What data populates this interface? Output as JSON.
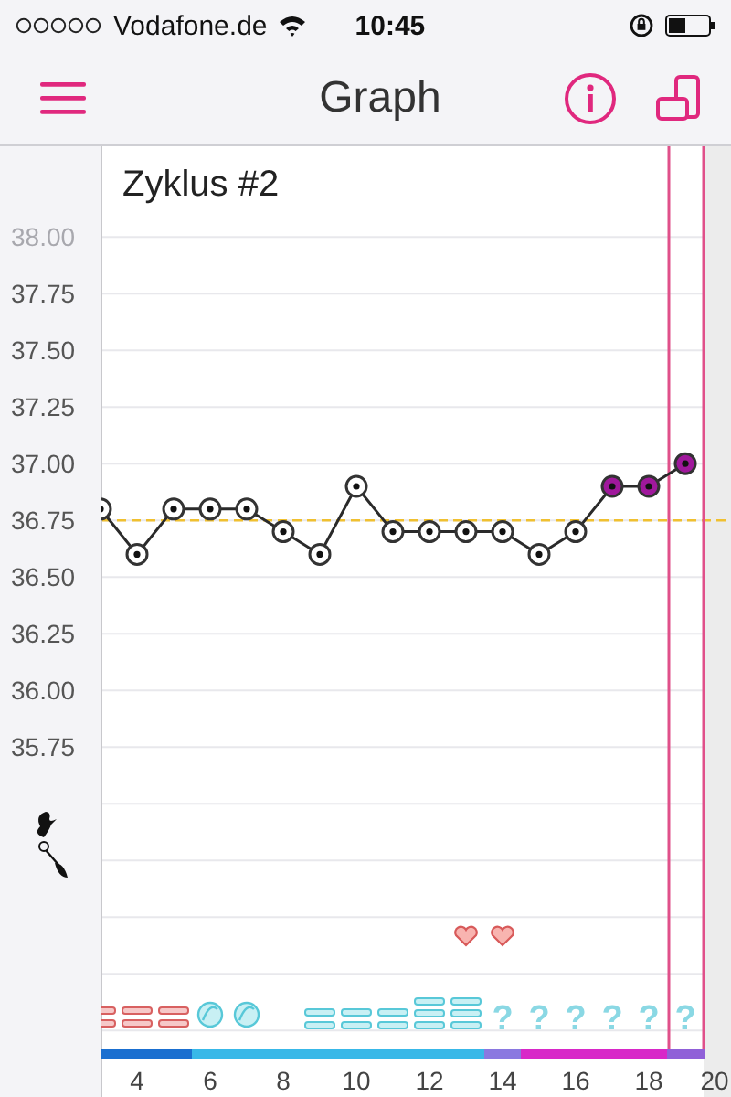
{
  "status_bar": {
    "carrier": "Vodafone.de",
    "time": "10:45"
  },
  "nav_bar": {
    "title": "Graph"
  },
  "chart": {
    "title": "Zyklus #2",
    "chart_data": {
      "type": "line",
      "x": [
        3,
        4,
        5,
        6,
        7,
        8,
        9,
        10,
        11,
        12,
        13,
        14,
        15,
        16,
        17,
        18,
        19
      ],
      "series": [
        {
          "color": "#ffffff",
          "marker": "circle",
          "values": [
            36.8,
            36.6,
            36.8,
            36.8,
            36.8,
            36.7,
            36.6,
            36.9,
            36.7,
            36.7,
            36.7,
            36.7,
            36.6,
            36.7,
            null,
            null,
            null
          ]
        },
        {
          "color": "#a0189c",
          "marker": "circle",
          "values": [
            null,
            null,
            null,
            null,
            null,
            null,
            null,
            null,
            null,
            null,
            null,
            null,
            null,
            36.7,
            36.9,
            36.9,
            37.0
          ]
        }
      ],
      "xlim": [
        3,
        20.25
      ],
      "ylim": [
        34.21,
        38.4
      ],
      "grid": true,
      "xticks": [
        4,
        6,
        8,
        10,
        12,
        14,
        16,
        18,
        20
      ],
      "yticks": [
        {
          "value": 38,
          "label": "38.00"
        },
        {
          "value": 37.75,
          "label": "37.75"
        },
        {
          "value": 37.5,
          "label": "37.50"
        },
        {
          "value": 37.25,
          "label": "37.25"
        },
        {
          "value": 37,
          "label": "37.00"
        },
        {
          "value": 36.75,
          "label": "36.75"
        },
        {
          "value": 36.5,
          "label": "36.50"
        },
        {
          "value": 36.25,
          "label": "36.25"
        },
        {
          "value": 36,
          "label": "36.00"
        },
        {
          "value": 35.75,
          "label": "35.75"
        }
      ],
      "ref_lines": [
        {
          "axis": "y",
          "value": 36.75,
          "color": "#f0c030"
        },
        {
          "axis": "x",
          "value": 18.55,
          "color": "#e0508a"
        },
        {
          "axis": "x",
          "value": 19.5,
          "color": "#e0508a"
        }
      ],
      "bands": [
        {
          "axis": "x",
          "from": 19.5,
          "to": 20.25,
          "color": "#ececec"
        }
      ]
    },
    "phases": [
      {
        "color": "#1a6fd0"
      },
      {
        "color": "#1a6fd0"
      },
      {
        "color": "#1a6fd0"
      },
      {
        "color": "#38b8e8"
      },
      {
        "color": "#38b8e8"
      },
      {
        "color": "#38b8e8"
      },
      {
        "color": "#38b8e8"
      },
      {
        "color": "#38b8e8"
      },
      {
        "color": "#38b8e8"
      },
      {
        "color": "#38b8e8"
      },
      {
        "color": "#38b8e8"
      },
      {
        "color": "#8a78e0"
      },
      {
        "color": "#d828c8"
      },
      {
        "color": "#d828c8"
      },
      {
        "color": "#d828c8"
      },
      {
        "color": "#d828c8"
      },
      {
        "color": "#9060d8"
      }
    ],
    "upper_symbols": [
      {
        "kind": "none"
      },
      {
        "kind": "none"
      },
      {
        "kind": "none"
      },
      {
        "kind": "none"
      },
      {
        "kind": "none"
      },
      {
        "kind": "none"
      },
      {
        "kind": "none"
      },
      {
        "kind": "none"
      },
      {
        "kind": "none"
      },
      {
        "kind": "none"
      },
      {
        "kind": "heart"
      },
      {
        "kind": "heart"
      },
      {
        "kind": "none"
      },
      {
        "kind": "none"
      },
      {
        "kind": "none"
      },
      {
        "kind": "none"
      },
      {
        "kind": "none"
      }
    ],
    "symbols": [
      {
        "kind": "bleeding"
      },
      {
        "kind": "bleeding"
      },
      {
        "kind": "bleeding"
      },
      {
        "kind": "swirl"
      },
      {
        "kind": "swirl"
      },
      {
        "kind": "none"
      },
      {
        "kind": "double"
      },
      {
        "kind": "double"
      },
      {
        "kind": "double"
      },
      {
        "kind": "triple"
      },
      {
        "kind": "triple"
      },
      {
        "kind": "question",
        "text": "?"
      },
      {
        "kind": "question",
        "text": "?"
      },
      {
        "kind": "question",
        "text": "?"
      },
      {
        "kind": "question",
        "text": "?"
      },
      {
        "kind": "question",
        "text": "?"
      },
      {
        "kind": "question",
        "text": "?"
      }
    ]
  }
}
